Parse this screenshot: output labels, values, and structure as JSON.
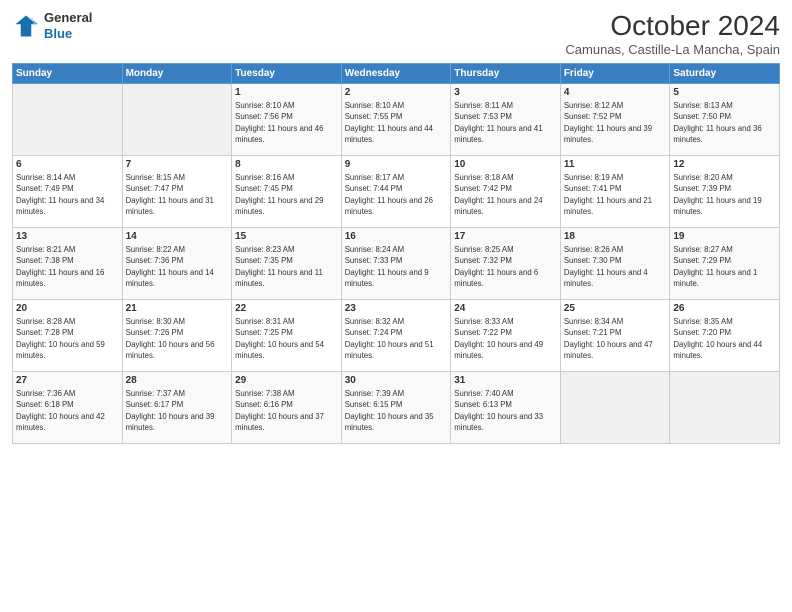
{
  "header": {
    "logo": {
      "general": "General",
      "blue": "Blue"
    },
    "title": "October 2024",
    "location": "Camunas, Castille-La Mancha, Spain"
  },
  "calendar": {
    "days_of_week": [
      "Sunday",
      "Monday",
      "Tuesday",
      "Wednesday",
      "Thursday",
      "Friday",
      "Saturday"
    ],
    "weeks": [
      [
        {
          "day": "",
          "info": ""
        },
        {
          "day": "",
          "info": ""
        },
        {
          "day": "1",
          "info": "Sunrise: 8:10 AM\nSunset: 7:56 PM\nDaylight: 11 hours and 46 minutes."
        },
        {
          "day": "2",
          "info": "Sunrise: 8:10 AM\nSunset: 7:55 PM\nDaylight: 11 hours and 44 minutes."
        },
        {
          "day": "3",
          "info": "Sunrise: 8:11 AM\nSunset: 7:53 PM\nDaylight: 11 hours and 41 minutes."
        },
        {
          "day": "4",
          "info": "Sunrise: 8:12 AM\nSunset: 7:52 PM\nDaylight: 11 hours and 39 minutes."
        },
        {
          "day": "5",
          "info": "Sunrise: 8:13 AM\nSunset: 7:50 PM\nDaylight: 11 hours and 36 minutes."
        }
      ],
      [
        {
          "day": "6",
          "info": "Sunrise: 8:14 AM\nSunset: 7:49 PM\nDaylight: 11 hours and 34 minutes."
        },
        {
          "day": "7",
          "info": "Sunrise: 8:15 AM\nSunset: 7:47 PM\nDaylight: 11 hours and 31 minutes."
        },
        {
          "day": "8",
          "info": "Sunrise: 8:16 AM\nSunset: 7:45 PM\nDaylight: 11 hours and 29 minutes."
        },
        {
          "day": "9",
          "info": "Sunrise: 8:17 AM\nSunset: 7:44 PM\nDaylight: 11 hours and 26 minutes."
        },
        {
          "day": "10",
          "info": "Sunrise: 8:18 AM\nSunset: 7:42 PM\nDaylight: 11 hours and 24 minutes."
        },
        {
          "day": "11",
          "info": "Sunrise: 8:19 AM\nSunset: 7:41 PM\nDaylight: 11 hours and 21 minutes."
        },
        {
          "day": "12",
          "info": "Sunrise: 8:20 AM\nSunset: 7:39 PM\nDaylight: 11 hours and 19 minutes."
        }
      ],
      [
        {
          "day": "13",
          "info": "Sunrise: 8:21 AM\nSunset: 7:38 PM\nDaylight: 11 hours and 16 minutes."
        },
        {
          "day": "14",
          "info": "Sunrise: 8:22 AM\nSunset: 7:36 PM\nDaylight: 11 hours and 14 minutes."
        },
        {
          "day": "15",
          "info": "Sunrise: 8:23 AM\nSunset: 7:35 PM\nDaylight: 11 hours and 11 minutes."
        },
        {
          "day": "16",
          "info": "Sunrise: 8:24 AM\nSunset: 7:33 PM\nDaylight: 11 hours and 9 minutes."
        },
        {
          "day": "17",
          "info": "Sunrise: 8:25 AM\nSunset: 7:32 PM\nDaylight: 11 hours and 6 minutes."
        },
        {
          "day": "18",
          "info": "Sunrise: 8:26 AM\nSunset: 7:30 PM\nDaylight: 11 hours and 4 minutes."
        },
        {
          "day": "19",
          "info": "Sunrise: 8:27 AM\nSunset: 7:29 PM\nDaylight: 11 hours and 1 minute."
        }
      ],
      [
        {
          "day": "20",
          "info": "Sunrise: 8:28 AM\nSunset: 7:28 PM\nDaylight: 10 hours and 59 minutes."
        },
        {
          "day": "21",
          "info": "Sunrise: 8:30 AM\nSunset: 7:26 PM\nDaylight: 10 hours and 56 minutes."
        },
        {
          "day": "22",
          "info": "Sunrise: 8:31 AM\nSunset: 7:25 PM\nDaylight: 10 hours and 54 minutes."
        },
        {
          "day": "23",
          "info": "Sunrise: 8:32 AM\nSunset: 7:24 PM\nDaylight: 10 hours and 51 minutes."
        },
        {
          "day": "24",
          "info": "Sunrise: 8:33 AM\nSunset: 7:22 PM\nDaylight: 10 hours and 49 minutes."
        },
        {
          "day": "25",
          "info": "Sunrise: 8:34 AM\nSunset: 7:21 PM\nDaylight: 10 hours and 47 minutes."
        },
        {
          "day": "26",
          "info": "Sunrise: 8:35 AM\nSunset: 7:20 PM\nDaylight: 10 hours and 44 minutes."
        }
      ],
      [
        {
          "day": "27",
          "info": "Sunrise: 7:36 AM\nSunset: 6:18 PM\nDaylight: 10 hours and 42 minutes."
        },
        {
          "day": "28",
          "info": "Sunrise: 7:37 AM\nSunset: 6:17 PM\nDaylight: 10 hours and 39 minutes."
        },
        {
          "day": "29",
          "info": "Sunrise: 7:38 AM\nSunset: 6:16 PM\nDaylight: 10 hours and 37 minutes."
        },
        {
          "day": "30",
          "info": "Sunrise: 7:39 AM\nSunset: 6:15 PM\nDaylight: 10 hours and 35 minutes."
        },
        {
          "day": "31",
          "info": "Sunrise: 7:40 AM\nSunset: 6:13 PM\nDaylight: 10 hours and 33 minutes."
        },
        {
          "day": "",
          "info": ""
        },
        {
          "day": "",
          "info": ""
        }
      ]
    ]
  }
}
